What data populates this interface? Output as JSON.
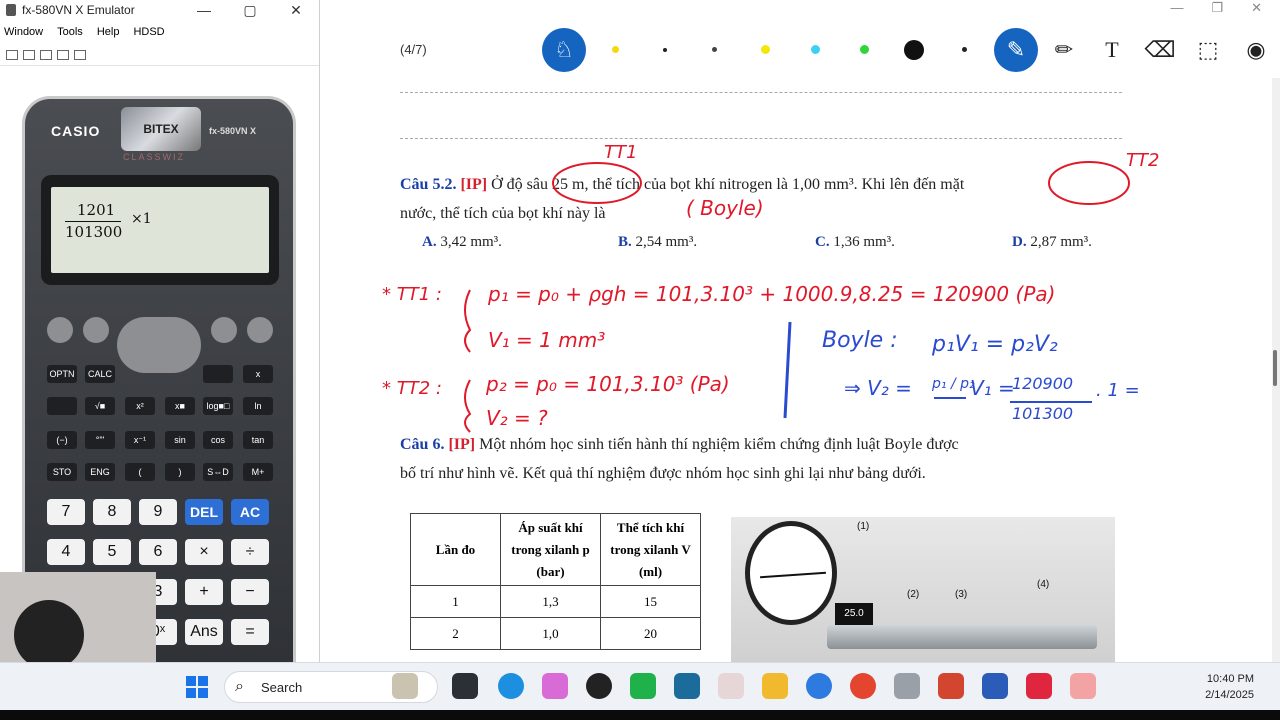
{
  "emulator": {
    "title": "fx-580VN X Emulator",
    "menu": [
      "Window",
      "Tools",
      "Help",
      "HDSD"
    ],
    "brand": "CASIO",
    "logo_text": "BITEX",
    "model": "fx-580VN X",
    "series": "CLASSWIZ",
    "display": {
      "numerator": "1201",
      "denominator": "101300",
      "suffix": "×1"
    },
    "control_keys": [
      "OPTN",
      "CALC",
      "",
      "x",
      "",
      "√■",
      "x²",
      "x■",
      "log■□",
      "ln",
      "(−)",
      "°'\"",
      "x⁻¹",
      "sin",
      "cos",
      "tan",
      "STO",
      "ENG",
      "(",
      ")",
      "S⇔D",
      "M+"
    ],
    "keys_row1": [
      "7",
      "8",
      "9",
      "DEL",
      "AC"
    ],
    "keys_row2": [
      "4",
      "5",
      "6",
      "×",
      "÷"
    ],
    "keys_row3": [
      "3",
      "+",
      "−"
    ],
    "keys_row4": [
      "0ˣ",
      "Ans",
      "="
    ]
  },
  "viewer": {
    "page_counter": "(4/7)",
    "window_controls": [
      "—",
      "❐",
      "✕"
    ]
  },
  "question52": {
    "number": "Câu 5.2.",
    "tag": "[IP]",
    "line1": "Ở độ sâu 25 m, thể tích của bọt khí nitrogen là 1,00 mm³. Khi lên đến mặt",
    "line2": "nước, thể tích của bọt khí này là",
    "options": [
      {
        "letter": "A.",
        "text": "3,42 mm³."
      },
      {
        "letter": "B.",
        "text": "2,54 mm³."
      },
      {
        "letter": "C.",
        "text": "1,36 mm³."
      },
      {
        "letter": "D.",
        "text": "2,87 mm³."
      }
    ]
  },
  "annotations": {
    "tt1_mark": "TT1",
    "tt2_mark": "TT2",
    "boyle_note": "( Boyle)",
    "tt1_label": "* TT1 :",
    "tt1_eq1": "p₁ = p₀ + ρgh = 101,3.10³ + 1000.9,8.25 = 120900 (Pa)",
    "tt1_eq2": "V₁ = 1 mm³",
    "tt2_label": "* TT2 :",
    "tt2_eq1": "p₂ = p₀ = 101,3.10³ (Pa)",
    "tt2_eq2": "V₂ = ?",
    "boyle_title": "Boyle :",
    "boyle_eq": "p₁V₁ = p₂V₂",
    "solve_lhs": "⇒ V₂ =",
    "solve_frac": "p₁ / p₂",
    "solve_v1": "V₁ =",
    "solve_num": "120900",
    "solve_den": "101300",
    "solve_tail": ". 1 ="
  },
  "question6": {
    "number": "Câu 6.",
    "tag": "[IP]",
    "line1": "Một nhóm học sinh tiến hành thí nghiệm kiểm chứng định luật Boyle được",
    "line2": "bố trí như hình vẽ. Kết quả thí nghiệm được nhóm học sinh ghi lại như bảng dưới."
  },
  "table": {
    "headers": [
      "Lần đo",
      "Áp suất khí trong xilanh p (bar)",
      "Thể tích khí trong xilanh V (ml)"
    ],
    "rows": [
      [
        "1",
        "1,3",
        "15"
      ],
      [
        "2",
        "1,0",
        "20"
      ]
    ]
  },
  "photo": {
    "labels": [
      "(1)",
      "(2)",
      "(3)",
      "(4)"
    ],
    "display": "25.0"
  },
  "taskbar": {
    "search_placeholder": "Search",
    "time": "10:40 PM",
    "date": "2/14/2025"
  },
  "colors": {
    "accent": "#1565c0",
    "question_blue": "#1a3ea8",
    "tag_red": "#d3212f",
    "ink_red": "#e0192a",
    "ink_blue": "#2a4bd0"
  }
}
